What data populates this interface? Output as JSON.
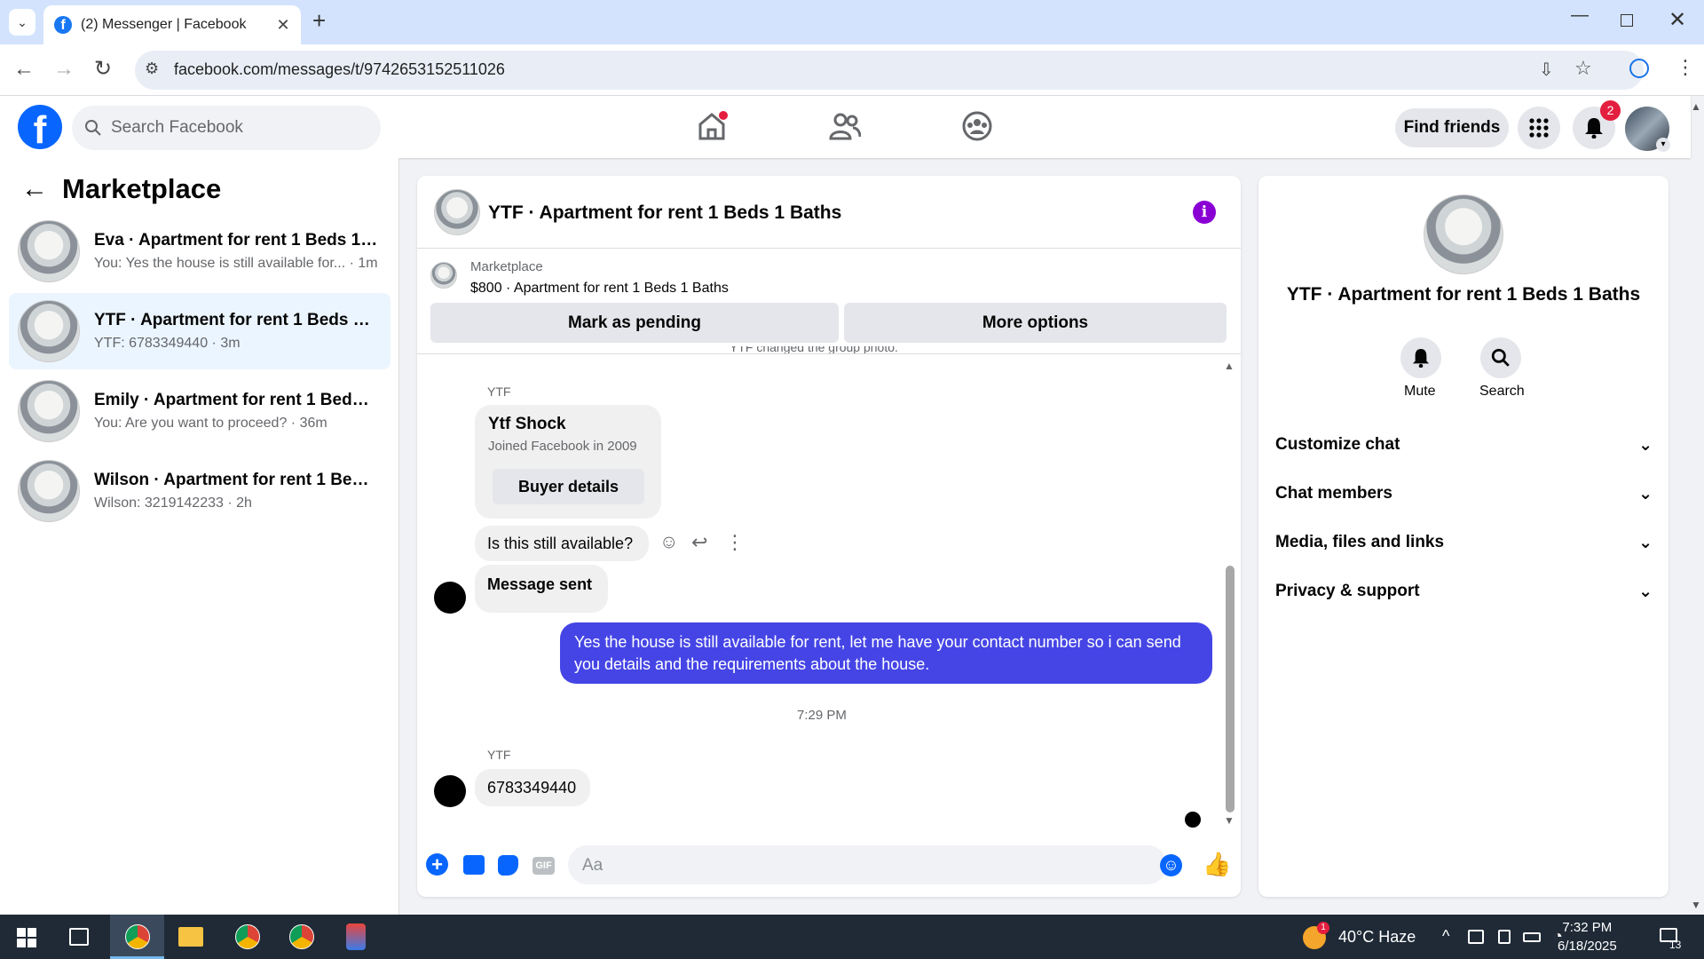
{
  "browser": {
    "tab_title": "(2) Messenger | Facebook",
    "url": "facebook.com/messages/t/9742653152511026"
  },
  "header": {
    "search_placeholder": "Search Facebook",
    "find_friends": "Find friends",
    "notification_count": "2"
  },
  "sidebar": {
    "title": "Marketplace",
    "conversations": [
      {
        "name": "Eva · Apartment for rent 1 Beds 1 B...",
        "snippet": "You: Yes the house is still available for... · 1m"
      },
      {
        "name": "YTF · Apartment for rent 1 Beds 1 ...",
        "snippet": "YTF: 6783349440 · 3m"
      },
      {
        "name": "Emily · Apartment for rent 1 Beds 1...",
        "snippet": "You: Are you want to proceed? · 36m"
      },
      {
        "name": "Wilson · Apartment for rent 1 Beds...",
        "snippet": "Wilson: 3219142233 · 2h"
      }
    ]
  },
  "chat": {
    "title": "YTF · Apartment for rent 1 Beds 1 Baths",
    "listing_label": "Marketplace",
    "listing": "$800 · Apartment for rent 1 Beds 1 Baths",
    "mark_pending": "Mark as pending",
    "more_options": "More options",
    "system_note": "YTF changed the group photo.",
    "sender": "YTF",
    "profile_name": "Ytf Shock",
    "profile_joined": "Joined Facebook in 2009",
    "buyer_details": "Buyer details",
    "msg1": "Is this still available?",
    "msg2": "Message sent",
    "msg3": "Yes the house is still available for rent, let me have your contact number so i can send you details and the requirements about the house.",
    "timestamp": "7:29 PM",
    "sender2": "YTF",
    "msg4": "6783349440",
    "composer_placeholder": "Aa"
  },
  "info_panel": {
    "title": "YTF · Apartment for rent 1 Beds 1 Baths",
    "mute": "Mute",
    "search": "Search",
    "sections": [
      "Customize chat",
      "Chat members",
      "Media, files and links",
      "Privacy & support"
    ]
  },
  "taskbar": {
    "weather": "40°C  Haze",
    "time": "7:32 PM",
    "date": "6/18/2025",
    "weather_badge": "1",
    "notif_count": "13"
  },
  "colors": {
    "fb_blue": "#0866ff",
    "sent_bubble": "#4545e6",
    "active_conv": "#ebf5ff"
  }
}
